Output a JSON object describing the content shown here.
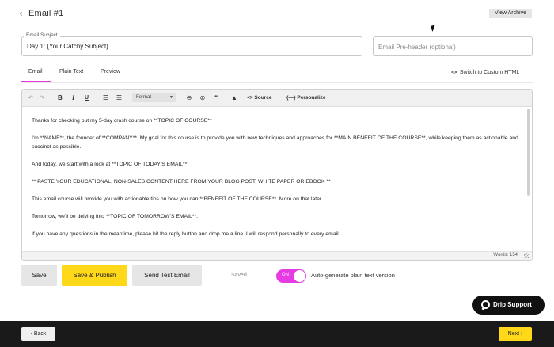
{
  "header": {
    "back_glyph": "‹",
    "title": "Email #1",
    "view_archive_label": "View Archive"
  },
  "subject": {
    "label": "Email Subject",
    "value": "Day 1: {Your Catchy Subject}"
  },
  "preheader": {
    "placeholder": "Email Pre-header (optional)"
  },
  "tabs": [
    {
      "label": "Email",
      "active": true
    },
    {
      "label": "Plain Text",
      "active": false
    },
    {
      "label": "Preview",
      "active": false
    }
  ],
  "switch_html": {
    "icon": "<>",
    "label": "Switch to Custom HTML"
  },
  "toolbar": {
    "undo_icon": "↶",
    "redo_icon": "↷",
    "bold": "B",
    "italic": "I",
    "underline": "U",
    "ul_icon": "☰",
    "ol_icon": "☰",
    "format_label": "Format",
    "format_arrow": "▼",
    "link_icon": "⊖",
    "unlink_icon": "⊘",
    "quote_icon": "❝",
    "image_icon": "▲",
    "source_label": "<> Source",
    "personalize_label": "{—} Personalize"
  },
  "body": {
    "paragraphs": [
      "Thanks for checking out my 5-day crash course on **TOPIC OF COURSE**",
      "I'm **NAME**, the founder of **COMPANY**. My goal for this course is to provide you with new techniques and approaches for **MAIN BENEFIT OF THE COURSE**, while keeping them as actionable and succinct as possible.",
      "And today, we start with a look at **TOPIC OF TODAY'S EMAIL**.",
      "** PASTE YOUR EDUCATIONAL, NON-SALES CONTENT HERE FROM YOUR BLOG POST, WHITE PAPER OR EBOOK **",
      "This email course will provide you with actionable tips on how you can **BENEFIT OF THE COURSE**. More on that later...",
      "Tomorrow, we'll be delving into **TOPIC OF TOMORROW'S EMAIL**.",
      "If you have any questions in the meantime, please hit the reply button and drop me a line. I will respond personally to every email."
    ],
    "words": "Words: 154"
  },
  "actions": {
    "save_label": "Save",
    "publish_label": "Save & Publish",
    "test_label": "Send Test Email",
    "saved_label": "Saved",
    "toggle_label": "ON",
    "autogen_label": "Auto-generate plain text version"
  },
  "support": {
    "label": "Drip Support"
  },
  "footer": {
    "back_label": "‹ Back",
    "next_label": "Next ›"
  },
  "colors": {
    "accent_pink": "#e63ae3",
    "accent_yellow": "#ffd819",
    "footer_bg": "#1a1a1a"
  }
}
